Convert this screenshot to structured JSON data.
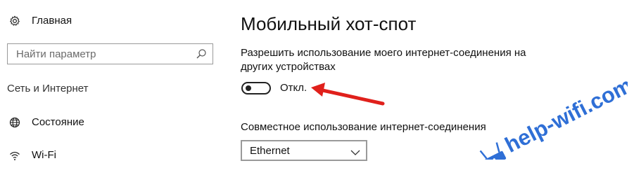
{
  "sidebar": {
    "home_label": "Главная",
    "search": {
      "placeholder": "Найти параметр",
      "value": ""
    },
    "section_label": "Сеть и Интернет",
    "items": [
      {
        "label": "Состояние",
        "icon": "globe-icon"
      },
      {
        "label": "Wi-Fi",
        "icon": "wifi-icon"
      }
    ]
  },
  "main": {
    "title": "Мобильный хот-спот",
    "share_setting": {
      "description": "Разрешить использование моего интернет-соединения на других устройствах",
      "toggle_state_label": "Откл.",
      "toggle_on": false
    },
    "connection": {
      "label": "Совместное использование интернет-соединения",
      "selected": "Ethernet"
    }
  },
  "watermark": {
    "text": "help-wifi.com",
    "color": "#2f6fd6"
  },
  "colors": {
    "annotation_arrow": "#e0201b",
    "text": "#111111",
    "border": "#9a9a9a"
  }
}
